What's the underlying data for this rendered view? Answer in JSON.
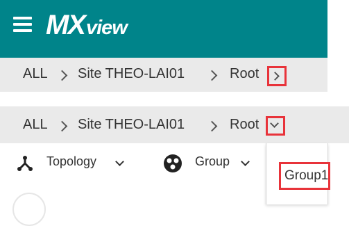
{
  "header": {
    "logo_mx": "MX",
    "logo_view": "view",
    "bg_color": "#00848a"
  },
  "breadcrumb_top": {
    "items": [
      "ALL",
      "Site THEO-LAI01",
      "Root"
    ]
  },
  "breadcrumb_bottom": {
    "items": [
      "ALL",
      "Site THEO-LAI01",
      "Root"
    ]
  },
  "toolbar": {
    "topology_label": "Topology",
    "group_label": "Group"
  },
  "dropdown": {
    "items": [
      "Group1"
    ]
  },
  "highlight_color": "#e8333a"
}
